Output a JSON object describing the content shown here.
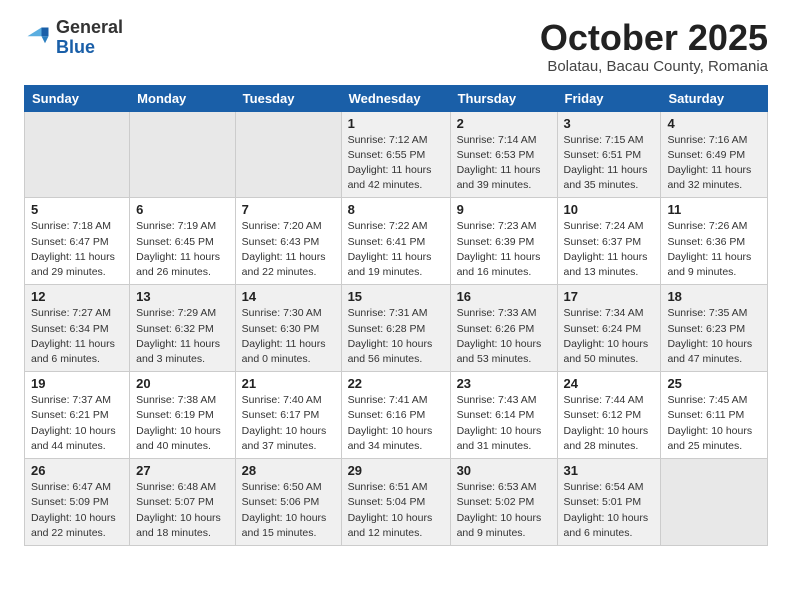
{
  "header": {
    "logo_general": "General",
    "logo_blue": "Blue",
    "month_title": "October 2025",
    "location": "Bolatau, Bacau County, Romania"
  },
  "weekdays": [
    "Sunday",
    "Monday",
    "Tuesday",
    "Wednesday",
    "Thursday",
    "Friday",
    "Saturday"
  ],
  "weeks": [
    [
      {
        "day": "",
        "info": ""
      },
      {
        "day": "",
        "info": ""
      },
      {
        "day": "",
        "info": ""
      },
      {
        "day": "1",
        "info": "Sunrise: 7:12 AM\nSunset: 6:55 PM\nDaylight: 11 hours\nand 42 minutes."
      },
      {
        "day": "2",
        "info": "Sunrise: 7:14 AM\nSunset: 6:53 PM\nDaylight: 11 hours\nand 39 minutes."
      },
      {
        "day": "3",
        "info": "Sunrise: 7:15 AM\nSunset: 6:51 PM\nDaylight: 11 hours\nand 35 minutes."
      },
      {
        "day": "4",
        "info": "Sunrise: 7:16 AM\nSunset: 6:49 PM\nDaylight: 11 hours\nand 32 minutes."
      }
    ],
    [
      {
        "day": "5",
        "info": "Sunrise: 7:18 AM\nSunset: 6:47 PM\nDaylight: 11 hours\nand 29 minutes."
      },
      {
        "day": "6",
        "info": "Sunrise: 7:19 AM\nSunset: 6:45 PM\nDaylight: 11 hours\nand 26 minutes."
      },
      {
        "day": "7",
        "info": "Sunrise: 7:20 AM\nSunset: 6:43 PM\nDaylight: 11 hours\nand 22 minutes."
      },
      {
        "day": "8",
        "info": "Sunrise: 7:22 AM\nSunset: 6:41 PM\nDaylight: 11 hours\nand 19 minutes."
      },
      {
        "day": "9",
        "info": "Sunrise: 7:23 AM\nSunset: 6:39 PM\nDaylight: 11 hours\nand 16 minutes."
      },
      {
        "day": "10",
        "info": "Sunrise: 7:24 AM\nSunset: 6:37 PM\nDaylight: 11 hours\nand 13 minutes."
      },
      {
        "day": "11",
        "info": "Sunrise: 7:26 AM\nSunset: 6:36 PM\nDaylight: 11 hours\nand 9 minutes."
      }
    ],
    [
      {
        "day": "12",
        "info": "Sunrise: 7:27 AM\nSunset: 6:34 PM\nDaylight: 11 hours\nand 6 minutes."
      },
      {
        "day": "13",
        "info": "Sunrise: 7:29 AM\nSunset: 6:32 PM\nDaylight: 11 hours\nand 3 minutes."
      },
      {
        "day": "14",
        "info": "Sunrise: 7:30 AM\nSunset: 6:30 PM\nDaylight: 11 hours\nand 0 minutes."
      },
      {
        "day": "15",
        "info": "Sunrise: 7:31 AM\nSunset: 6:28 PM\nDaylight: 10 hours\nand 56 minutes."
      },
      {
        "day": "16",
        "info": "Sunrise: 7:33 AM\nSunset: 6:26 PM\nDaylight: 10 hours\nand 53 minutes."
      },
      {
        "day": "17",
        "info": "Sunrise: 7:34 AM\nSunset: 6:24 PM\nDaylight: 10 hours\nand 50 minutes."
      },
      {
        "day": "18",
        "info": "Sunrise: 7:35 AM\nSunset: 6:23 PM\nDaylight: 10 hours\nand 47 minutes."
      }
    ],
    [
      {
        "day": "19",
        "info": "Sunrise: 7:37 AM\nSunset: 6:21 PM\nDaylight: 10 hours\nand 44 minutes."
      },
      {
        "day": "20",
        "info": "Sunrise: 7:38 AM\nSunset: 6:19 PM\nDaylight: 10 hours\nand 40 minutes."
      },
      {
        "day": "21",
        "info": "Sunrise: 7:40 AM\nSunset: 6:17 PM\nDaylight: 10 hours\nand 37 minutes."
      },
      {
        "day": "22",
        "info": "Sunrise: 7:41 AM\nSunset: 6:16 PM\nDaylight: 10 hours\nand 34 minutes."
      },
      {
        "day": "23",
        "info": "Sunrise: 7:43 AM\nSunset: 6:14 PM\nDaylight: 10 hours\nand 31 minutes."
      },
      {
        "day": "24",
        "info": "Sunrise: 7:44 AM\nSunset: 6:12 PM\nDaylight: 10 hours\nand 28 minutes."
      },
      {
        "day": "25",
        "info": "Sunrise: 7:45 AM\nSunset: 6:11 PM\nDaylight: 10 hours\nand 25 minutes."
      }
    ],
    [
      {
        "day": "26",
        "info": "Sunrise: 6:47 AM\nSunset: 5:09 PM\nDaylight: 10 hours\nand 22 minutes."
      },
      {
        "day": "27",
        "info": "Sunrise: 6:48 AM\nSunset: 5:07 PM\nDaylight: 10 hours\nand 18 minutes."
      },
      {
        "day": "28",
        "info": "Sunrise: 6:50 AM\nSunset: 5:06 PM\nDaylight: 10 hours\nand 15 minutes."
      },
      {
        "day": "29",
        "info": "Sunrise: 6:51 AM\nSunset: 5:04 PM\nDaylight: 10 hours\nand 12 minutes."
      },
      {
        "day": "30",
        "info": "Sunrise: 6:53 AM\nSunset: 5:02 PM\nDaylight: 10 hours\nand 9 minutes."
      },
      {
        "day": "31",
        "info": "Sunrise: 6:54 AM\nSunset: 5:01 PM\nDaylight: 10 hours\nand 6 minutes."
      },
      {
        "day": "",
        "info": ""
      }
    ]
  ]
}
